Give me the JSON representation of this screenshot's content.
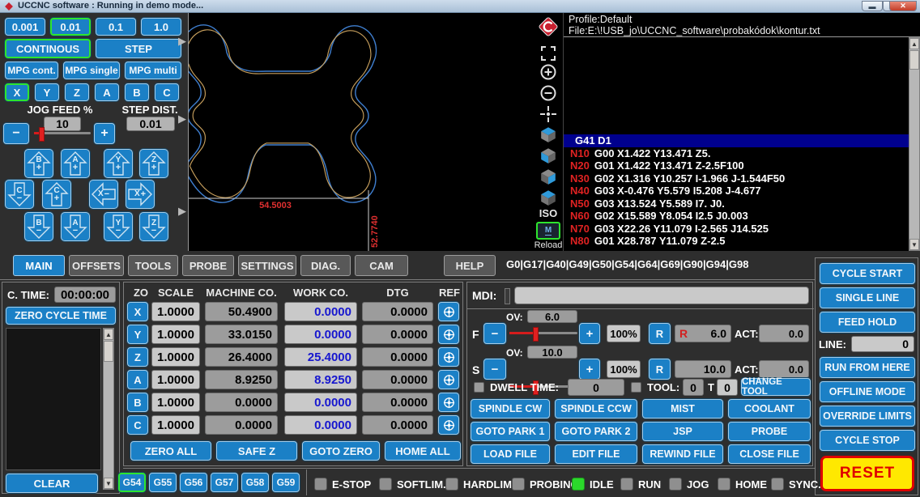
{
  "window": {
    "title": "UCCNC software : Running in demo mode..."
  },
  "jog": {
    "steps": [
      "0.001",
      "0.01",
      "0.1",
      "1.0"
    ],
    "modes": [
      "CONTINOUS",
      "STEP"
    ],
    "mpg": [
      "MPG cont.",
      "MPG single",
      "MPG multi"
    ],
    "axes": [
      "X",
      "Y",
      "Z",
      "A",
      "B",
      "C"
    ],
    "jog_feed_label": "JOG FEED %",
    "jog_feed_value": "10",
    "step_dist_label": "STEP DIST.",
    "step_dist_value": "0.01",
    "minus": "−",
    "plus": "+",
    "arrows": [
      {
        "letter": "B",
        "sign": "+"
      },
      {
        "letter": "A",
        "sign": "+"
      },
      {
        "letter": "Y",
        "sign": "+"
      },
      {
        "letter": "Z",
        "sign": "+"
      },
      {
        "letter": "C",
        "sign": "−"
      },
      {
        "letter": "C",
        "sign": "+"
      },
      {
        "letter": "X",
        "sign": "−"
      },
      {
        "letter": "X",
        "sign": "+"
      },
      {
        "letter": "B",
        "sign": "−"
      },
      {
        "letter": "A",
        "sign": "−"
      },
      {
        "letter": "Y",
        "sign": "−"
      },
      {
        "letter": "Z",
        "sign": "−"
      }
    ]
  },
  "toolpath": {
    "dim_width": "54.5003",
    "dim_height": "52.7740"
  },
  "view": {
    "iso": "ISO",
    "m": "M",
    "reload": "Reload"
  },
  "gcode": {
    "profile": "Profile:Default",
    "file": "File:E:\\!USB_jo\\UCCNC_software\\probakódok\\kontur.txt",
    "lines": [
      {
        "n": "",
        "code": "G41 D1"
      },
      {
        "n": "N10",
        "code": "G00 X1.422 Y13.471 Z5."
      },
      {
        "n": "N20",
        "code": "G01 X1.422 Y13.471 Z-2.5F100"
      },
      {
        "n": "N30",
        "code": "G02 X1.316 Y10.257 I-1.966 J-1.544F50"
      },
      {
        "n": "N40",
        "code": "G03 X-0.476 Y5.579 I5.208 J-4.677"
      },
      {
        "n": "N50",
        "code": "G03 X13.524 Y5.589 I7. J0."
      },
      {
        "n": "N60",
        "code": "G02 X15.589 Y8.054 I2.5 J0.003"
      },
      {
        "n": "N70",
        "code": "G03 X22.26 Y11.079 I-2.565 J14.525"
      },
      {
        "n": "N80",
        "code": "G01 X28.787 Y11.079 Z-2.5"
      }
    ]
  },
  "tabs": [
    "MAIN",
    "OFFSETS",
    "TOOLS",
    "PROBE",
    "SETTINGS",
    "DIAG.",
    "CAM",
    "HELP"
  ],
  "modal_gcodes": "G0|G17|G40|G49|G50|G54|G64|G69|G90|G94|G98",
  "cycle": {
    "label": "C. TIME:",
    "value": "00:00:00",
    "zero": "ZERO CYCLE TIME",
    "clear": "CLEAR"
  },
  "dro": {
    "headers": [
      "ZO",
      "SCALE",
      "MACHINE CO.",
      "WORK CO.",
      "DTG",
      "REF"
    ],
    "rows": [
      {
        "axis": "X",
        "scale": "1.0000",
        "machine": "50.4900",
        "work": "0.0000",
        "dtg": "0.0000"
      },
      {
        "axis": "Y",
        "scale": "1.0000",
        "machine": "33.0150",
        "work": "0.0000",
        "dtg": "0.0000"
      },
      {
        "axis": "Z",
        "scale": "1.0000",
        "machine": "26.4000",
        "work": "25.4000",
        "dtg": "0.0000"
      },
      {
        "axis": "A",
        "scale": "1.0000",
        "machine": "8.9250",
        "work": "8.9250",
        "dtg": "0.0000"
      },
      {
        "axis": "B",
        "scale": "1.0000",
        "machine": "0.0000",
        "work": "0.0000",
        "dtg": "0.0000"
      },
      {
        "axis": "C",
        "scale": "1.0000",
        "machine": "0.0000",
        "work": "0.0000",
        "dtg": "0.0000"
      }
    ],
    "buttons": [
      "ZERO ALL",
      "SAFE Z",
      "GOTO ZERO",
      "HOME ALL"
    ]
  },
  "mdi": {
    "label": "MDI:",
    "f": {
      "axis": "F",
      "ov_label": "OV:",
      "ov": "6.0",
      "minus": "−",
      "plus": "+",
      "pct": "100%",
      "r_btn": "R",
      "r_prefix": "R",
      "value": "6.0",
      "act_label": "ACT:",
      "act": "0.0"
    },
    "s": {
      "axis": "S",
      "ov_label": "OV:",
      "ov": "10.0",
      "minus": "−",
      "plus": "+",
      "pct": "100%",
      "r_btn": "R",
      "r_prefix": "",
      "value": "10.0",
      "act_label": "ACT:",
      "act": "0.0"
    },
    "dwell_label": "DWELL TIME:",
    "dwell_value": "0",
    "tool_label": "TOOL:",
    "tool_value": "0",
    "t_label": "T",
    "t_value": "0",
    "change_tool": "CHANGE TOOL",
    "grid": [
      [
        "SPINDLE CW",
        "SPINDLE CCW",
        "MIST",
        "COOLANT"
      ],
      [
        "GOTO PARK 1",
        "GOTO PARK 2",
        "JSP",
        "PROBE"
      ],
      [
        "LOAD FILE",
        "EDIT FILE",
        "REWIND FILE",
        "CLOSE FILE"
      ]
    ]
  },
  "run": {
    "buttons": [
      "CYCLE START",
      "SINGLE LINE",
      "FEED HOLD"
    ],
    "line_label": "LINE:",
    "line_value": "0",
    "buttons2": [
      "RUN FROM HERE",
      "OFFLINE MODE",
      "OVERRIDE LIMITS",
      "CYCLE STOP"
    ],
    "reset": "RESET"
  },
  "status": {
    "work_offsets": [
      "G54",
      "G55",
      "G56",
      "G57",
      "G58",
      "G59"
    ],
    "leds": [
      {
        "label": "E-STOP",
        "on": false
      },
      {
        "label": "SOFTLIM.",
        "on": false
      },
      {
        "label": "HARDLIM.",
        "on": false
      },
      {
        "label": "PROBING",
        "on": false
      },
      {
        "label": "IDLE",
        "on": true
      },
      {
        "label": "RUN",
        "on": false
      },
      {
        "label": "JOG",
        "on": false
      },
      {
        "label": "HOME",
        "on": false
      },
      {
        "label": "SYNC.",
        "on": false
      }
    ]
  },
  "colors": {
    "accent_blue": "#1b80c6",
    "selected_green": "#2ee52e",
    "led_on": "#2bd82b",
    "path_outer": "#3f7fd0",
    "path_inner": "#c9a15e",
    "dim_red": "#e03030",
    "reset_yellow": "#ffe800",
    "reset_red": "#df0000",
    "highlight_line": "#00008e"
  }
}
